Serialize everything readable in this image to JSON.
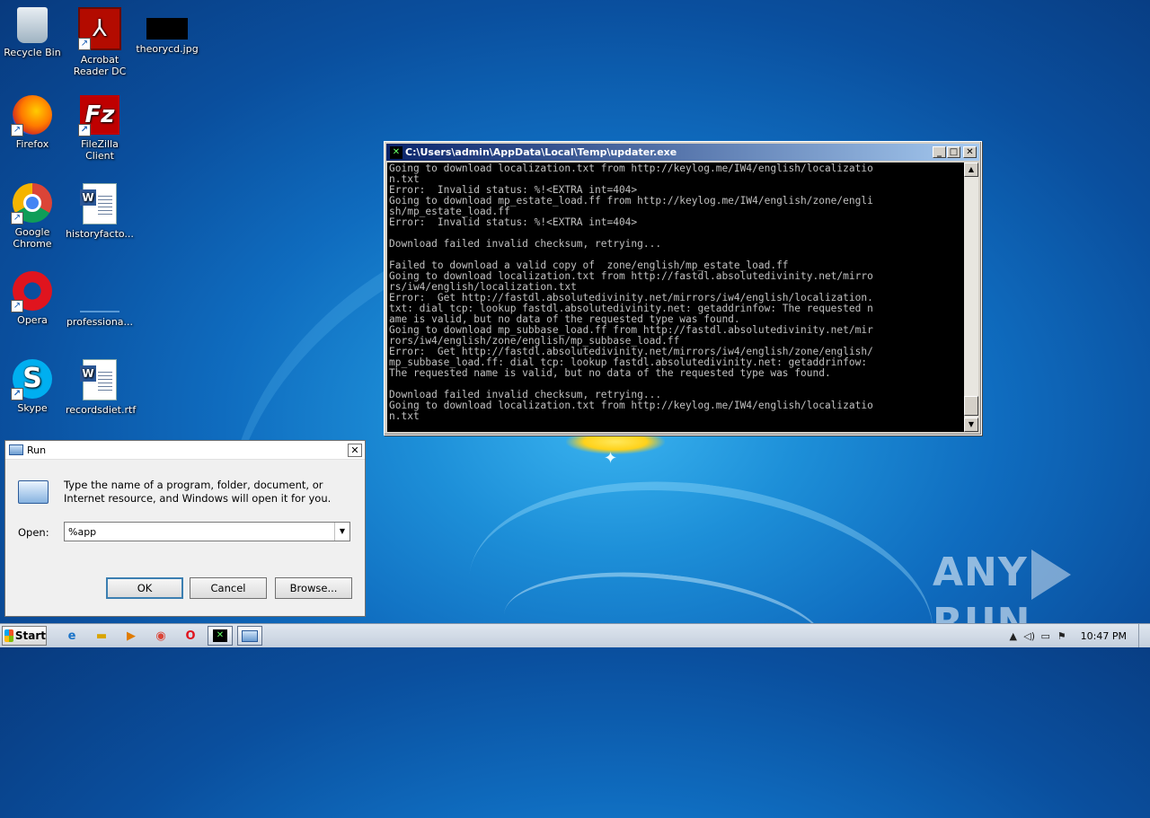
{
  "desktop": {
    "icons": [
      {
        "label": "Recycle Bin"
      },
      {
        "label": "Acrobat Reader DC"
      },
      {
        "label": "theorycd.jpg"
      },
      {
        "label": "Firefox"
      },
      {
        "label": "FileZilla Client"
      },
      {
        "label": "Google Chrome"
      },
      {
        "label": "historyfacto..."
      },
      {
        "label": "Opera"
      },
      {
        "label": "professiona..."
      },
      {
        "label": "Skype"
      },
      {
        "label": "recordsdiet.rtf"
      }
    ]
  },
  "console": {
    "title": "C:\\Users\\admin\\AppData\\Local\\Temp\\updater.exe",
    "lines": [
      "Going to download localization.txt from http://keylog.me/IW4/english/localizatio",
      "n.txt",
      "Error:  Invalid status: %!<EXTRA int=404>",
      "Going to download mp_estate_load.ff from http://keylog.me/IW4/english/zone/engli",
      "sh/mp_estate_load.ff",
      "Error:  Invalid status: %!<EXTRA int=404>",
      "",
      "Download failed invalid checksum, retrying...",
      "",
      "Failed to download a valid copy of  zone/english/mp_estate_load.ff",
      "Going to download localization.txt from http://fastdl.absolutedivinity.net/mirro",
      "rs/iw4/english/localization.txt",
      "Error:  Get http://fastdl.absolutedivinity.net/mirrors/iw4/english/localization.",
      "txt: dial tcp: lookup fastdl.absolutedivinity.net: getaddrinfow: The requested n",
      "ame is valid, but no data of the requested type was found.",
      "Going to download mp_subbase_load.ff from http://fastdl.absolutedivinity.net/mir",
      "rors/iw4/english/zone/english/mp_subbase_load.ff",
      "Error:  Get http://fastdl.absolutedivinity.net/mirrors/iw4/english/zone/english/",
      "mp_subbase_load.ff: dial tcp: lookup fastdl.absolutedivinity.net: getaddrinfow:",
      "The requested name is valid, but no data of the requested type was found.",
      "",
      "Download failed invalid checksum, retrying...",
      "Going to download localization.txt from http://keylog.me/IW4/english/localizatio",
      "n.txt"
    ]
  },
  "run_dialog": {
    "title": "Run",
    "description": "Type the name of a program, folder, document, or Internet resource, and Windows will open it for you.",
    "open_label": "Open:",
    "open_value": "%app",
    "ok_label": "OK",
    "cancel_label": "Cancel",
    "browse_label": "Browse..."
  },
  "watermark": {
    "left": "ANY",
    "right": "RUN"
  },
  "taskbar": {
    "start_label": "Start",
    "clock": "10:47 PM"
  }
}
